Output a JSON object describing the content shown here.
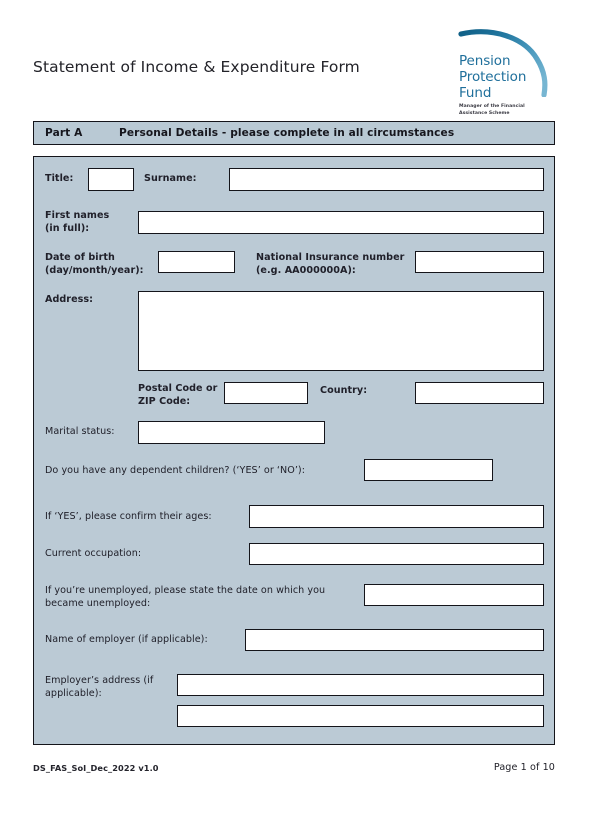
{
  "document": {
    "title": "Statement of Income & Expenditure Form"
  },
  "logo": {
    "line1": "Pension",
    "line2": "Protection",
    "line3": "Fund",
    "strapline": "Manager of the Financial Assistance Scheme",
    "arc_color_dark": "#1b6e94",
    "arc_color_light": "#5aa6c8",
    "text_color": "#1f6f9b"
  },
  "part_header": {
    "part_label": "Part A",
    "description": "Personal Details - please complete in all circumstances",
    "background": "#b9c9d4"
  },
  "panel": {
    "background": "#bbcad5",
    "border_color": "#14141a"
  },
  "fields": {
    "title_label": "Title:",
    "title_value": "",
    "surname_label": "Surname:",
    "surname_value": "",
    "first_names_label": "First names\n(in full):",
    "first_names_value": "",
    "date_of_birth_label": "Date of birth\n(day/month/year):",
    "date_of_birth_value": "",
    "ni_number_label": "National Insurance number\n(e.g. AA000000A):",
    "ni_number_value": "",
    "address_label": "Address:",
    "address_value": "",
    "postal_code_label": "Postal Code or\nZIP Code:",
    "postal_code_value": "",
    "country_label": "Country:",
    "country_value": "",
    "marital_status_label": "Marital status:",
    "marital_status_value": "",
    "dependent_children_label": "Do you have any dependent children? (‘YES’ or ‘NO’):",
    "dependent_children_value": "",
    "children_ages_label": "If ‘YES’, please confirm their ages:",
    "children_ages_value": "",
    "current_occupation_label": "Current occupation:",
    "current_occupation_value": "",
    "unemployed_date_label": "If you’re unemployed, please state the date on which you\nbecame unemployed:",
    "unemployed_date_value": "",
    "employer_name_label": "Name of employer (if applicable):",
    "employer_name_value": "",
    "employer_address_label": "Employer’s address (if\napplicable):",
    "employer_address_line1": "",
    "employer_address_line2": ""
  },
  "footer": {
    "reference": "DS_FAS_SoI_Dec_2022 v1.0",
    "page": "Page 1 of 10"
  }
}
